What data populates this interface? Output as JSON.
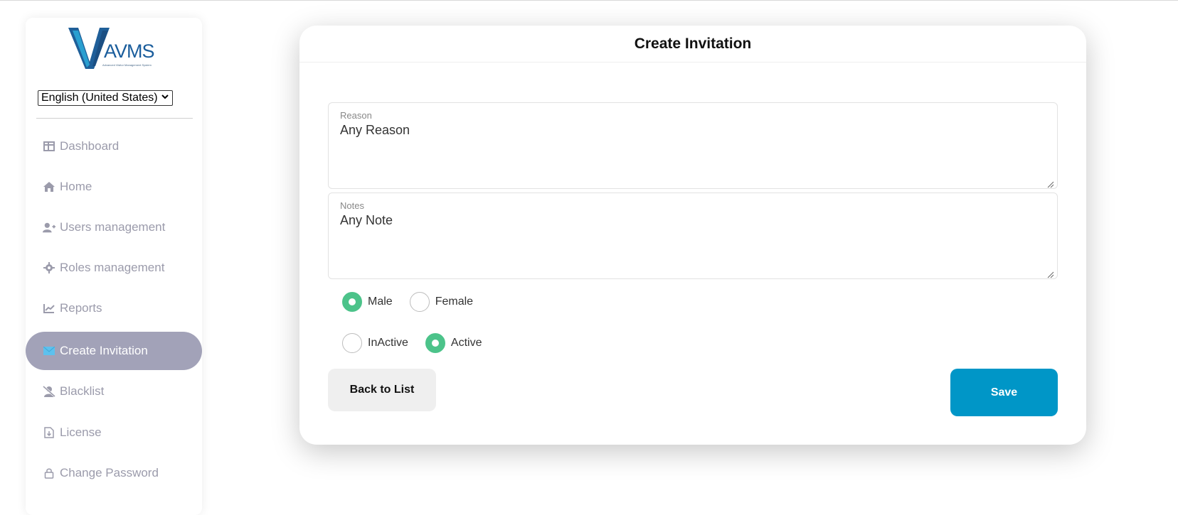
{
  "colors": {
    "accent": "#0096c7",
    "active_nav_bg": "#a2a2b8",
    "radio_on": "#4cc38a",
    "nav_text": "#9b9bab"
  },
  "sidebar": {
    "logo_text": "AVMS",
    "logo_subtitle": "Advanced Visitor Management System",
    "language_select": "English (United States)",
    "items": [
      {
        "label": "Dashboard",
        "icon": "dashboard-icon"
      },
      {
        "label": "Home",
        "icon": "home-icon"
      },
      {
        "label": "Users management",
        "icon": "user-plus-icon"
      },
      {
        "label": "Roles management",
        "icon": "gear-icon"
      },
      {
        "label": "Reports",
        "icon": "chart-line-icon"
      },
      {
        "label": "Create Invitation",
        "icon": "envelope-icon",
        "active": true
      },
      {
        "label": "Blacklist",
        "icon": "user-slash-icon"
      },
      {
        "label": "License",
        "icon": "file-download-icon"
      },
      {
        "label": "Change Password",
        "icon": "lock-icon"
      }
    ]
  },
  "form": {
    "title": "Create Invitation",
    "reason": {
      "label": "Reason",
      "value": "Any Reason"
    },
    "notes": {
      "label": "Notes",
      "value": "Any Note"
    },
    "gender": {
      "options": [
        {
          "label": "Male",
          "selected": true
        },
        {
          "label": "Female",
          "selected": false
        }
      ]
    },
    "status": {
      "options": [
        {
          "label": "InActive",
          "selected": false
        },
        {
          "label": "Active",
          "selected": true
        }
      ]
    },
    "back_label": "Back to List",
    "save_label": "Save"
  }
}
